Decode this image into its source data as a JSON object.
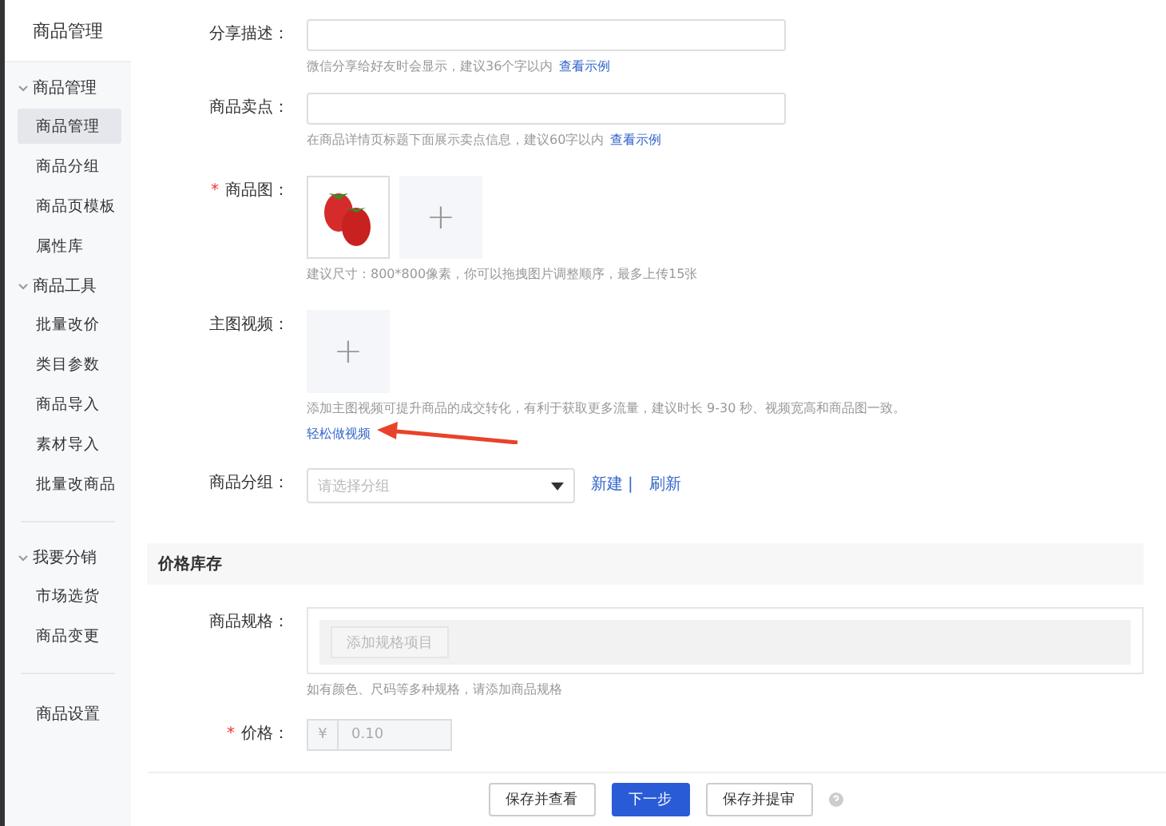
{
  "sidebar": {
    "title": "商品管理",
    "groups": [
      {
        "label": "商品管理",
        "expanded": true,
        "items": [
          {
            "label": "商品管理",
            "selected": true
          },
          {
            "label": "商品分组",
            "selected": false
          },
          {
            "label": "商品页模板",
            "selected": false
          },
          {
            "label": "属性库",
            "selected": false
          }
        ]
      },
      {
        "label": "商品工具",
        "expanded": true,
        "items": [
          {
            "label": "批量改价",
            "selected": false
          },
          {
            "label": "类目参数",
            "selected": false
          },
          {
            "label": "商品导入",
            "selected": false
          },
          {
            "label": "素材导入",
            "selected": false
          },
          {
            "label": "批量改商品",
            "selected": false
          }
        ]
      },
      {
        "label": "我要分销",
        "expanded": true,
        "items": [
          {
            "label": "市场选货",
            "selected": false
          },
          {
            "label": "商品变更",
            "selected": false
          }
        ]
      }
    ],
    "footer_item": "商品设置"
  },
  "form": {
    "share_desc": {
      "label": "分享描述：",
      "hint": "微信分享给好友时会显示，建议36个字以内",
      "link": "查看示例"
    },
    "selling_point": {
      "label": "商品卖点：",
      "hint": "在商品详情页标题下面展示卖点信息，建议60字以内",
      "link": "查看示例"
    },
    "images": {
      "label": "商品图：",
      "required": true,
      "required_mark": "*",
      "add": "+",
      "hint": "建议尺寸：800*800像素，你可以拖拽图片调整顺序，最多上传15张"
    },
    "video": {
      "label": "主图视频：",
      "add": "+",
      "hint": "添加主图视频可提升商品的成交转化，有利于获取更多流量，建议时长 9-30 秒、视频宽高和商品图一致。",
      "link": "轻松做视频"
    },
    "group": {
      "label": "商品分组：",
      "placeholder": "请选择分组",
      "new": "新建",
      "separator": "|",
      "refresh": "刷新"
    }
  },
  "section": {
    "title": "价格库存",
    "spec": {
      "label": "商品规格：",
      "button": "添加规格项目",
      "hint": "如有颜色、尺码等多种规格，请添加商品规格"
    },
    "price": {
      "label": "价格：",
      "required": true,
      "required_mark": "*",
      "currency": "¥",
      "value": "0.10"
    }
  },
  "footer": {
    "buttons": [
      {
        "label": "保存并查看",
        "kind": "default"
      },
      {
        "label": "下一步",
        "kind": "primary"
      },
      {
        "label": "保存并提审",
        "kind": "default"
      }
    ]
  }
}
